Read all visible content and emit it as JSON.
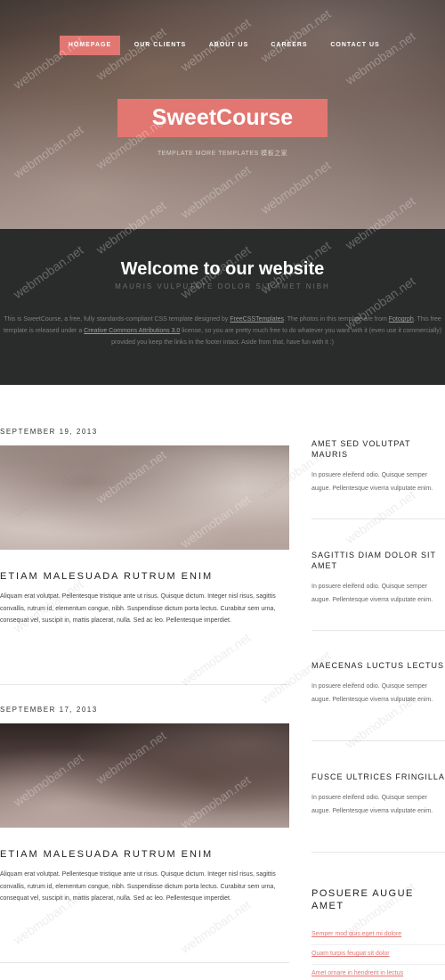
{
  "nav": {
    "items": [
      {
        "label": "HOMEPAGE",
        "active": true
      },
      {
        "label": "OUR CLIENTS",
        "active": false
      },
      {
        "label": "ABOUT US",
        "active": false
      },
      {
        "label": "CAREERS",
        "active": false
      },
      {
        "label": "CONTACT US",
        "active": false
      }
    ]
  },
  "header": {
    "logo": "SweetCourse",
    "tagline": "TEMPLATE MORE TEMPLATES 模板之家"
  },
  "welcome": {
    "title": "Welcome to our website",
    "subtitle": "MAURIS VULPUTATE DOLOR SIT AMET NIBH",
    "text_1": "This is ",
    "text_sweetcourse": "SweetCourse",
    "text_2": ", a free, fully standards-compliant CSS template designed by ",
    "link_freecss": "FreeCSSTemplates",
    "text_3": ". The photos in this template are from ",
    "link_fotogrph": "Fotogrph",
    "text_4": ". This free template is released under a ",
    "link_cc": "Creative Commons Attributions 3.0",
    "text_5": " license, so you are pretty much free to do whatever you want with it (even use it commercially) provided you keep the links in the footer intact. Aside from that, have fun with it :)"
  },
  "posts": [
    {
      "date": "SEPTEMBER 19, 2013",
      "title": "ETIAM MALESUADA RUTRUM ENIM",
      "body": "Aliquam erat volutpat. Pellentesque tristique ante ut risus. Quisque dictum. Integer nisl risus, sagittis convallis, rutrum id, elementum congue, nibh. Suspendisse dictum porta lectus. Curabitur sem urna, consequat vel, suscipit in, mattis placerat, nulla. Sed ac leo. Pellentesque imperdiet."
    },
    {
      "date": "SEPTEMBER 17, 2013",
      "title": "ETIAM MALESUADA RUTRUM ENIM",
      "body": "Aliquam erat volutpat. Pellentesque tristique ante ut risus. Quisque dictum. Integer nisl risus, sagittis convallis, rutrum id, elementum congue, nibh. Suspendisse dictum porta lectus. Curabitur sem urna, consequat vel, suscipit in, mattis placerat, nulla. Sed ac leo. Pellentesque imperdiet."
    }
  ],
  "sidebar": {
    "items": [
      {
        "title": "AMET SED VOLUTPAT MAURIS",
        "text": "In posuere eleifend odio. Quisque semper augue. Pellentesque viverra vulputate enim."
      },
      {
        "title": "SAGITTIS DIAM DOLOR SIT AMET",
        "text": "In posuere eleifend odio. Quisque semper augue. Pellentesque viverra vulputate enim."
      },
      {
        "title": "MAECENAS LUCTUS LECTUS",
        "text": "In posuere eleifend odio. Quisque semper augue. Pellentesque viverra vulputate enim."
      },
      {
        "title": "FUSCE ULTRICES FRINGILLA",
        "text": "In posuere eleifend odio. Quisque semper augue. Pellentesque viverra vulputate enim."
      }
    ],
    "links_title": "POSUERE AUGUE AMET",
    "links": [
      "Semper mod quis eget mi dolore",
      "Quam turpis feugiat sit dolor",
      "Amet ornare in hendrerit in lectus"
    ]
  },
  "watermark": "webmoban.net",
  "colors": {
    "accent": "#e27671",
    "dark_band": "#2a2b2b"
  }
}
